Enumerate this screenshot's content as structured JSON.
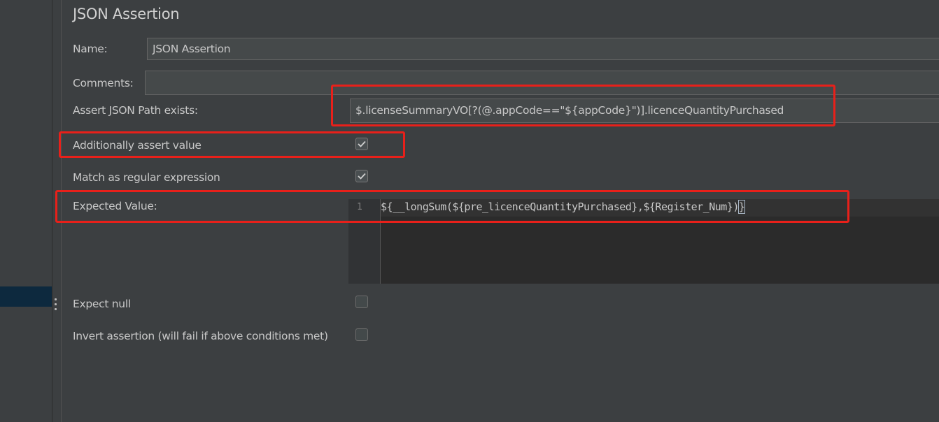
{
  "panel": {
    "title": "JSON Assertion",
    "name_label": "Name:",
    "name_value": "JSON Assertion",
    "comments_label": "Comments:",
    "comments_value": "",
    "json_path_label": "Assert JSON Path exists:",
    "json_path_value": "$.licenseSummaryVO[?(@.appCode==\"${appCode}\")].licenceQuantityPurchased",
    "additionally_assert_label": "Additionally assert value",
    "additionally_assert_checked": true,
    "match_regex_label": "Match as regular expression",
    "match_regex_checked": true,
    "expected_value_label": "Expected Value:",
    "expected_value_line_number": "1",
    "expected_value_open": "${",
    "expected_value_body": "__longSum(${pre_licenceQuantityPurchased},${Register_Num})",
    "expected_value_close": "}",
    "expect_null_label": "Expect null",
    "expect_null_checked": false,
    "invert_label": "Invert assertion (will fail if above conditions met)",
    "invert_checked": false
  },
  "colors": {
    "background": "#3c3f41",
    "highlight": "#e8201a",
    "editor_bg": "#2b2b2b"
  }
}
